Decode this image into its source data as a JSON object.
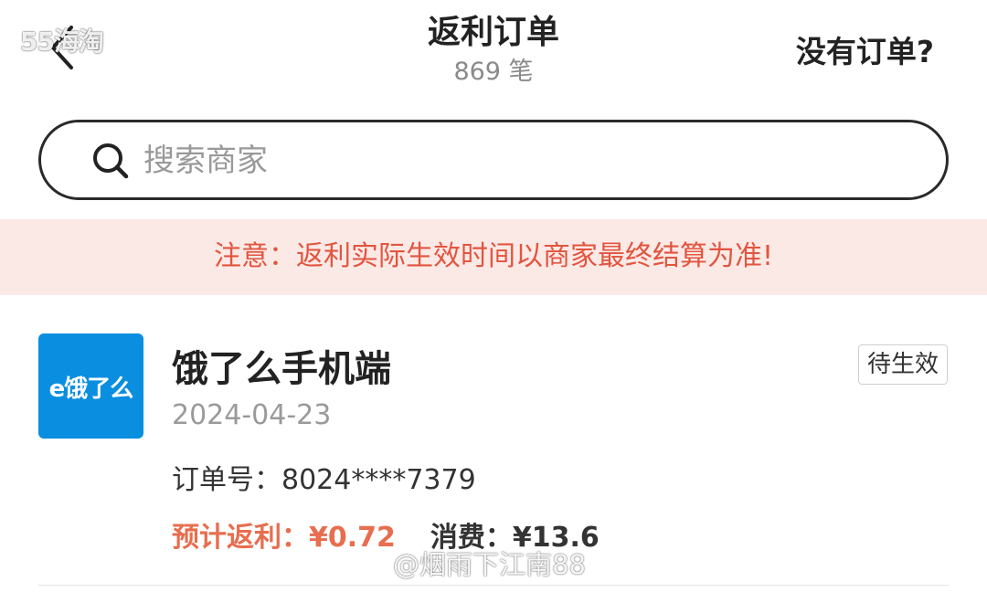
{
  "header": {
    "watermark": "55海淘",
    "title": "返利订单",
    "order_count": "869 笔",
    "no_order_link": "没有订单?"
  },
  "search": {
    "placeholder": "搜索商家"
  },
  "notice": {
    "text": "注意：返利实际生效时间以商家最终结算为准!"
  },
  "orders": [
    {
      "merchant_logo_text": "e饿了么",
      "merchant_name": "饿了么手机端",
      "status": "待生效",
      "date": "2024-04-23",
      "order_number_label": "订单号：",
      "order_number": "8024****7379",
      "rebate_label": "预计返利：",
      "rebate_value": "¥0.72",
      "spend_label": "消费：",
      "spend_value": "¥13.6"
    }
  ],
  "footer_watermark": "@烟雨下江南88",
  "colors": {
    "accent_orange": "#e76e4f",
    "notice_text": "#e2553f",
    "notice_bg": "#fbe9e6",
    "logo_blue": "#0a8ee0"
  },
  "icons": [
    "back-arrow-icon",
    "search-icon"
  ]
}
